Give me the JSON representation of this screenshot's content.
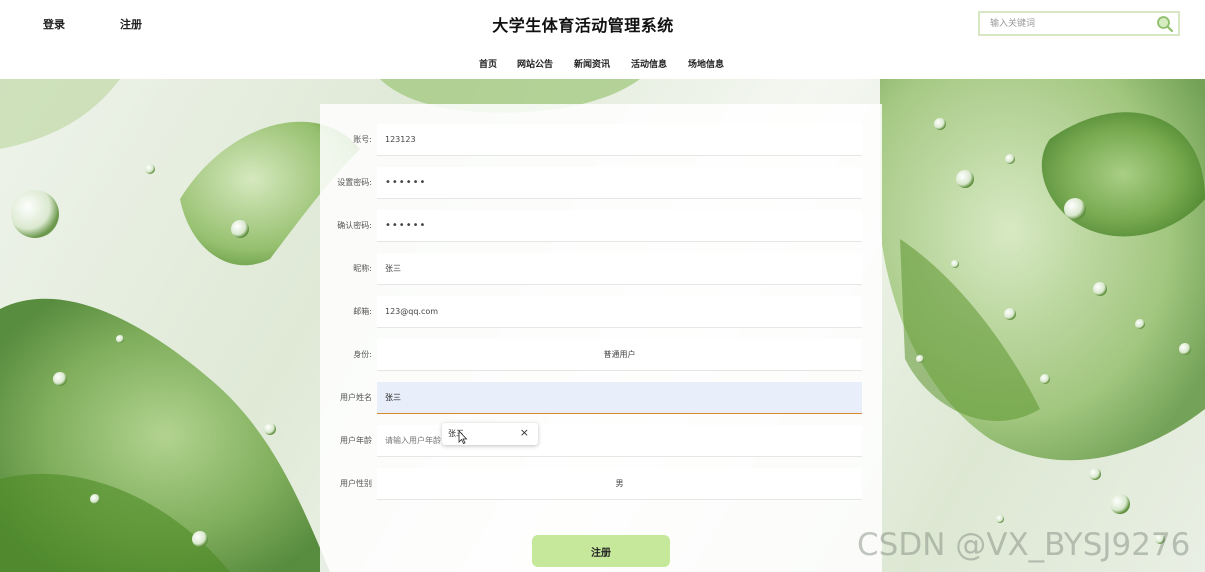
{
  "header": {
    "login_label": "登录",
    "register_label": "注册",
    "title": "大学生体育活动管理系统",
    "search": {
      "placeholder": "输入关键词",
      "icon": "search-icon"
    }
  },
  "nav": {
    "items": [
      {
        "label": "首页"
      },
      {
        "label": "网站公告"
      },
      {
        "label": "新闻资讯"
      },
      {
        "label": "活动信息"
      },
      {
        "label": "场地信息"
      }
    ]
  },
  "form": {
    "fields": [
      {
        "label": "账号:",
        "value": "123123"
      },
      {
        "label": "设置密码:",
        "value": "••••••"
      },
      {
        "label": "确认密码:",
        "value": "••••••"
      },
      {
        "label": "昵称:",
        "value": "张三"
      },
      {
        "label": "邮箱:",
        "value": "123@qq.com"
      },
      {
        "label": "身份:",
        "value": "普通用户"
      },
      {
        "label": "用户姓名",
        "value": "张三"
      },
      {
        "label": "用户年龄",
        "value": "",
        "placeholder": "请输入用户年龄"
      },
      {
        "label": "用户性别",
        "value": "男"
      }
    ],
    "autocomplete": {
      "suggestion": "张三",
      "close": "×"
    },
    "submit_label": "注册"
  },
  "watermark": "CSDN @VX_BYSJ9276",
  "colors": {
    "accent_button": "#c5e89a",
    "focus_border": "#d98b2b",
    "search_border": "#d7e7c4"
  }
}
